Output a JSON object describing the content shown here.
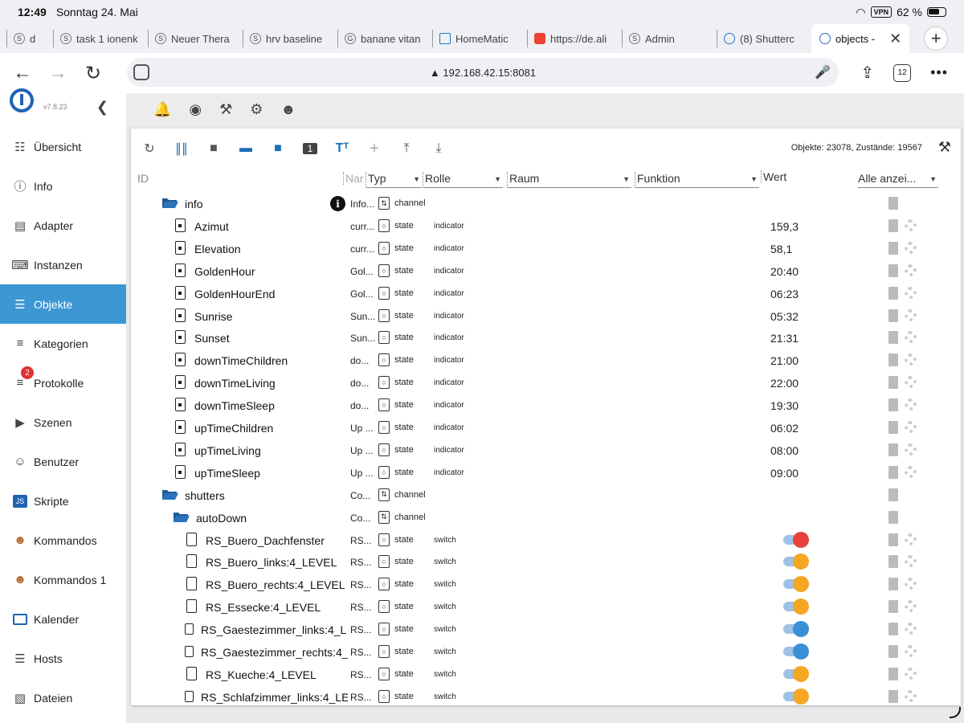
{
  "statusbar": {
    "time": "12:49",
    "date": "Sonntag 24. Mai",
    "vpn": "VPN",
    "battery": "62 %"
  },
  "tabs": [
    {
      "label": "d"
    },
    {
      "label": "task 1 ionenk"
    },
    {
      "label": "Neuer Thera"
    },
    {
      "label": "hrv baseline"
    },
    {
      "label": "banane vitan"
    },
    {
      "label": "HomeMatic"
    },
    {
      "label": "https://de.ali"
    },
    {
      "label": "Admin"
    },
    {
      "label": "(8) Shutterc"
    },
    {
      "label": "objects -"
    }
  ],
  "address": {
    "url": "192.168.42.15:8081",
    "tab_count": "12"
  },
  "sidebar": {
    "version": "v7.8.23",
    "items": [
      {
        "label": "Übersicht",
        "icon": "grid-icon"
      },
      {
        "label": "Info",
        "icon": "info-icon"
      },
      {
        "label": "Adapter",
        "icon": "store-icon"
      },
      {
        "label": "Instanzen",
        "icon": "keyboard-icon"
      },
      {
        "label": "Objekte",
        "icon": "list-icon"
      },
      {
        "label": "Kategorien",
        "icon": "categories-icon"
      },
      {
        "label": "Protokolle",
        "icon": "log-icon",
        "badge": "2"
      },
      {
        "label": "Szenen",
        "icon": "scenes-icon"
      },
      {
        "label": "Benutzer",
        "icon": "user-icon"
      },
      {
        "label": "Skripte",
        "icon": "js-icon"
      },
      {
        "label": "Kommandos",
        "icon": "person-icon"
      },
      {
        "label": "Kommandos 1",
        "icon": "person-icon"
      },
      {
        "label": "Kalender",
        "icon": "calendar-icon"
      },
      {
        "label": "Hosts",
        "icon": "hosts-icon"
      },
      {
        "label": "Dateien",
        "icon": "files-icon"
      }
    ]
  },
  "toolbar": {
    "counts": "Objekte: 23078, Zustände: 19567"
  },
  "columns": {
    "id": "ID",
    "name": "Nar",
    "typ": "Typ",
    "rolle": "Rolle",
    "raum": "Raum",
    "funktion": "Funktion",
    "wert": "Wert",
    "filter": "Alle anzei..."
  },
  "rows": [
    {
      "kind": "folder",
      "indent": 0,
      "id": "info",
      "name": "Info...",
      "typ": "channel",
      "rolle": "",
      "wert": "",
      "info": true
    },
    {
      "kind": "file",
      "indent": 1,
      "id": "Azimut",
      "name": "curr...",
      "typ": "state",
      "rolle": "indicator",
      "wert": "159,3"
    },
    {
      "kind": "file",
      "indent": 1,
      "id": "Elevation",
      "name": "curr...",
      "typ": "state",
      "rolle": "indicator",
      "wert": "58,1"
    },
    {
      "kind": "file",
      "indent": 1,
      "id": "GoldenHour",
      "name": "Gol...",
      "typ": "state",
      "rolle": "indicator",
      "wert": "20:40"
    },
    {
      "kind": "file",
      "indent": 1,
      "id": "GoldenHourEnd",
      "name": "Gol...",
      "typ": "state",
      "rolle": "indicator",
      "wert": "06:23"
    },
    {
      "kind": "file",
      "indent": 1,
      "id": "Sunrise",
      "name": "Sun...",
      "typ": "state",
      "rolle": "indicator",
      "wert": "05:32"
    },
    {
      "kind": "file",
      "indent": 1,
      "id": "Sunset",
      "name": "Sun...",
      "typ": "state",
      "rolle": "indicator",
      "wert": "21:31"
    },
    {
      "kind": "file",
      "indent": 1,
      "id": "downTimeChildren",
      "name": "do...",
      "typ": "state",
      "rolle": "indicator",
      "wert": "21:00"
    },
    {
      "kind": "file",
      "indent": 1,
      "id": "downTimeLiving",
      "name": "do...",
      "typ": "state",
      "rolle": "indicator",
      "wert": "22:00"
    },
    {
      "kind": "file",
      "indent": 1,
      "id": "downTimeSleep",
      "name": "do...",
      "typ": "state",
      "rolle": "indicator",
      "wert": "19:30"
    },
    {
      "kind": "file",
      "indent": 1,
      "id": "upTimeChildren",
      "name": "Up ...",
      "typ": "state",
      "rolle": "indicator",
      "wert": "06:02"
    },
    {
      "kind": "file",
      "indent": 1,
      "id": "upTimeLiving",
      "name": "Up ...",
      "typ": "state",
      "rolle": "indicator",
      "wert": "08:00"
    },
    {
      "kind": "file",
      "indent": 1,
      "id": "upTimeSleep",
      "name": "Up ...",
      "typ": "state",
      "rolle": "indicator",
      "wert": "09:00"
    },
    {
      "kind": "folder",
      "indent": 0,
      "id": "shutters",
      "name": "Co...",
      "typ": "channel",
      "rolle": "",
      "wert": ""
    },
    {
      "kind": "folder",
      "indent": 1,
      "id": "autoDown",
      "name": "Co...",
      "typ": "channel",
      "rolle": "",
      "wert": ""
    },
    {
      "kind": "file2",
      "indent": 2,
      "id": "RS_Buero_Dachfenster",
      "name": "RS...",
      "typ": "state",
      "rolle": "switch",
      "switch": "#e8413c"
    },
    {
      "kind": "file2",
      "indent": 2,
      "id": "RS_Buero_links:4_LEVEL",
      "name": "RS...",
      "typ": "state",
      "rolle": "switch",
      "switch": "#f5a623"
    },
    {
      "kind": "file2",
      "indent": 2,
      "id": "RS_Buero_rechts:4_LEVEL",
      "name": "RS...",
      "typ": "state",
      "rolle": "switch",
      "switch": "#f5a623"
    },
    {
      "kind": "file2",
      "indent": 2,
      "id": "RS_Essecke:4_LEVEL",
      "name": "RS...",
      "typ": "state",
      "rolle": "switch",
      "switch": "#f5a623"
    },
    {
      "kind": "file2s",
      "indent": 2,
      "id": "RS_Gaestezimmer_links:4_L",
      "name": "RS...",
      "typ": "state",
      "rolle": "switch",
      "switch": "#3a8fd6"
    },
    {
      "kind": "file2s",
      "indent": 2,
      "id": "RS_Gaestezimmer_rechts:4_",
      "name": "RS...",
      "typ": "state",
      "rolle": "switch",
      "switch": "#3a8fd6"
    },
    {
      "kind": "file2",
      "indent": 2,
      "id": "RS_Kueche:4_LEVEL",
      "name": "RS...",
      "typ": "state",
      "rolle": "switch",
      "switch": "#f5a623"
    },
    {
      "kind": "file2s",
      "indent": 2,
      "id": "RS_Schlafzimmer_links:4_LE",
      "name": "RS...",
      "typ": "state",
      "rolle": "switch",
      "switch": "#f5a623"
    }
  ]
}
